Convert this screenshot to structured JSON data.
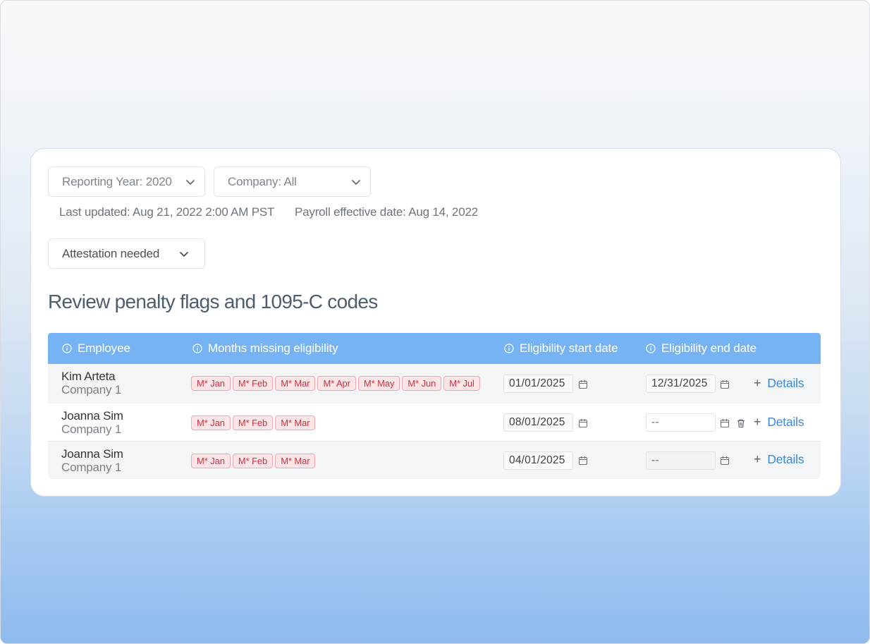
{
  "filters": {
    "reporting_year": "Reporting Year: 2020",
    "company": "Company: All",
    "status": "Attestation needed"
  },
  "meta": {
    "last_updated": "Last updated: Aug 21, 2022 2:00 AM PST",
    "payroll_effective": "Payroll effective date: Aug 14, 2022"
  },
  "heading": "Review penalty flags and 1095-C codes",
  "table": {
    "columns": [
      "Employee",
      "Months missing eligibility",
      "Eligibility start date",
      "Eligibility end date"
    ],
    "rows": [
      {
        "name": "Kim Arteta",
        "company": "Company 1",
        "months": [
          "M* Jan",
          "M* Feb",
          "M* Mar",
          "M* Apr",
          "M* May",
          "M* Jun",
          "M* Jul"
        ],
        "start_date": "01/01/2025",
        "end_date": "12/31/2025",
        "details": "Details"
      },
      {
        "name": "Joanna Sim",
        "company": "Company 1",
        "months": [
          "M* Jan",
          "M* Feb",
          "M* Mar"
        ],
        "start_date": "08/01/2025",
        "end_date": "--",
        "details": "Details"
      },
      {
        "name": "Joanna Sim",
        "company": "Company 1",
        "months": [
          "M* Jan",
          "M* Feb",
          "M* Mar"
        ],
        "start_date": "04/01/2025",
        "end_date": "--",
        "details": "Details"
      }
    ]
  },
  "colors": {
    "header_blue": "#75b3f5",
    "link_blue": "#3d88d6",
    "tag_red": "#d0313e",
    "tag_bg": "#fde4e6"
  },
  "icons": [
    "chevron-down-icon",
    "info-icon",
    "calendar-icon",
    "trash-icon",
    "plus-icon"
  ]
}
